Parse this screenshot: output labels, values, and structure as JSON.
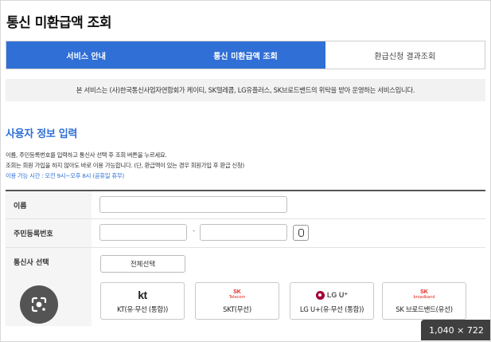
{
  "page": {
    "title": "통신 미환급액 조회"
  },
  "tabs": [
    {
      "label": "서비스 안내"
    },
    {
      "label": "통신 미환급액 조회"
    },
    {
      "label": "환급신청 결과조회"
    }
  ],
  "notice": {
    "text": "본 서비스는 (사)한국통신사업자연합회가 케이티, SK텔레콤, LG유플러스, SK브로드밴드의 위탁을 받아 운영하는 서비스입니다."
  },
  "section": {
    "title": "사용자 정보 입력",
    "desc_line1": "이름, 주민등록번호를 입력하고 통신사 선택 후 조회 버튼을 누르세요.",
    "desc_line2": "조회는 회원 가입을 하지 않아도 바로 이용 가능합니다. (단, 환급액이 있는 경우 회원가입 후 환급 신청)",
    "hours": "이용 가능 시간 : 오전 9시~오후 8시 (공휴일 휴무)"
  },
  "form": {
    "name_label": "이름",
    "name_value": "",
    "rrn_label": "주민등록번호",
    "rrn_first": "",
    "rrn_separator": "-",
    "rrn_second": "",
    "carrier_label": "통신사 선택",
    "select_all": "전체선택"
  },
  "carriers": [
    {
      "logo_text": "kt",
      "name": "KT(유·무선 (통합))"
    },
    {
      "logo_text": "SK",
      "logo_sub": "Telecom",
      "name": "SKT(무선)"
    },
    {
      "logo_text": "LG U⁺",
      "name": "LG U+(유·무선 (통합))"
    },
    {
      "logo_text": "SK",
      "logo_sub": "broadband",
      "name": "SK 브로드밴드(유선)"
    }
  ],
  "overlay": {
    "size_label": "1,040 × 722"
  },
  "icons": {
    "lens": "google-lens-icon",
    "keypad": "keypad-icon",
    "lg_logo": "lg-circle-logo"
  },
  "colors": {
    "accent": "#2f6fd6",
    "sk_red": "#e2231a",
    "lg_magenta": "#a50034"
  }
}
